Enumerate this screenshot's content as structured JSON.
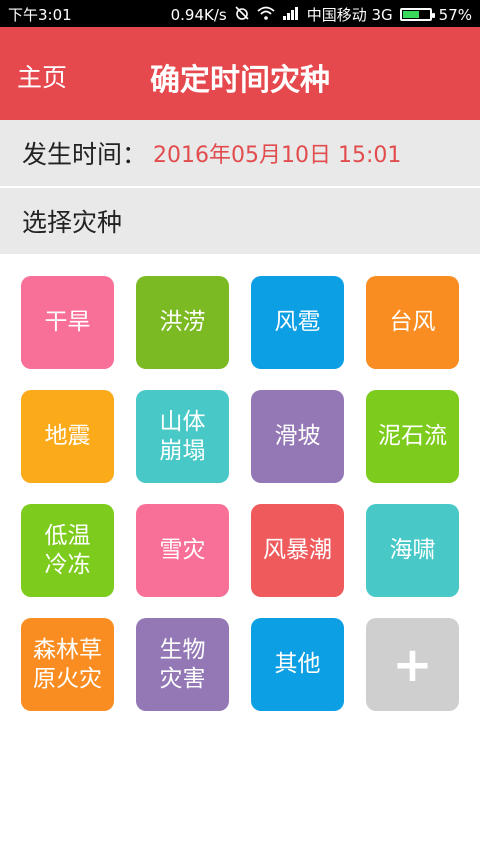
{
  "statusbar": {
    "time": "下午3:01",
    "speed": "0.94K/s",
    "carrier": "中国移动 3G",
    "battery": "57%",
    "battery_level": 0.57
  },
  "header": {
    "home": "主页",
    "title": "确定时间灾种"
  },
  "time_row": {
    "label": "发生时间：",
    "value": "2016年05月10日 15:01"
  },
  "section": {
    "label": "选择灾种"
  },
  "disasters": [
    {
      "name": "干旱",
      "color": "#f86f98"
    },
    {
      "name": "洪涝",
      "color": "#7cba23"
    },
    {
      "name": "风雹",
      "color": "#0d9fe3"
    },
    {
      "name": "台风",
      "color": "#f98d22"
    },
    {
      "name": "地震",
      "color": "#fbaa19"
    },
    {
      "name": "山体\n崩塌",
      "color": "#48c9c7"
    },
    {
      "name": "滑坡",
      "color": "#9478b6"
    },
    {
      "name": "泥石流",
      "color": "#7dcc1d"
    },
    {
      "name": "低温\n冷冻",
      "color": "#7dcc1d"
    },
    {
      "name": "雪灾",
      "color": "#f86f98"
    },
    {
      "name": "风暴潮",
      "color": "#ef5a5c"
    },
    {
      "name": "海啸",
      "color": "#48c9c7"
    },
    {
      "name": "森林草\n原火灾",
      "color": "#f98d22"
    },
    {
      "name": "生物\n灾害",
      "color": "#9478b6"
    },
    {
      "name": "其他",
      "color": "#0d9fe3"
    },
    {
      "name": "+",
      "color": "#cfcfcf",
      "icon": "plus-icon"
    }
  ]
}
